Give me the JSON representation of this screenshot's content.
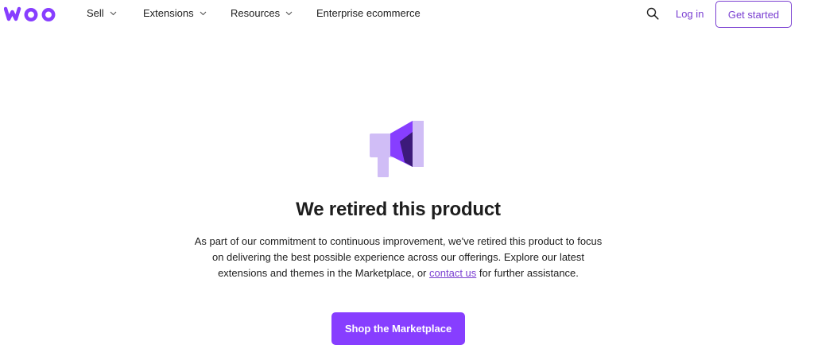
{
  "header": {
    "logo_text": "WOO",
    "nav": [
      {
        "label": "Sell",
        "has_dropdown": true
      },
      {
        "label": "Extensions",
        "has_dropdown": true
      },
      {
        "label": "Resources",
        "has_dropdown": true
      },
      {
        "label": "Enterprise ecommerce",
        "has_dropdown": false
      }
    ],
    "search_icon": "search-icon",
    "login_label": "Log in",
    "get_started_label": "Get started"
  },
  "main": {
    "icon": "megaphone-icon",
    "title": "We retired this product",
    "description_before_link": "As part of our commitment to continuous improvement, we've retired this product to focus on delivering the best possible experience across our offerings. Explore our latest extensions and themes in the Marketplace, or ",
    "link_text": "contact us",
    "description_after_link": " for further assistance.",
    "cta_label": "Shop the Marketplace"
  },
  "colors": {
    "brand_purple": "#873eff",
    "link_purple": "#7a3fd1",
    "icon_light": "#d0bdf6",
    "icon_dark": "#3c1a7a"
  }
}
